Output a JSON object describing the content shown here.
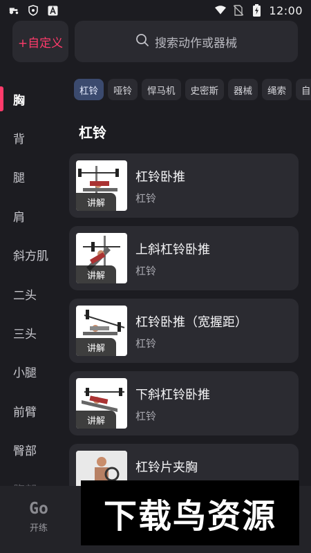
{
  "status_bar": {
    "time": "12:00"
  },
  "header": {
    "custom_label": "+自定义",
    "search_placeholder": "搜索动作或器械"
  },
  "sidebar": {
    "items": [
      "胸",
      "背",
      "腿",
      "肩",
      "斜方肌",
      "二头",
      "三头",
      "小腿",
      "前臂",
      "臀部",
      "腹部"
    ]
  },
  "chips": [
    "杠铃",
    "哑铃",
    "悍马机",
    "史密斯",
    "器械",
    "绳索",
    "自"
  ],
  "section_title": "杠铃",
  "exercises": [
    {
      "name": "杠铃卧推",
      "equipment": "杠铃",
      "tag": "讲解"
    },
    {
      "name": "上斜杠铃卧推",
      "equipment": "杠铃",
      "tag": "讲解"
    },
    {
      "name": "杠铃卧推（宽握距）",
      "equipment": "杠铃",
      "tag": "讲解"
    },
    {
      "name": "下斜杠铃卧推",
      "equipment": "杠铃",
      "tag": "讲解"
    },
    {
      "name": "杠铃片夹胸",
      "equipment": "",
      "tag": ""
    }
  ],
  "bottom_nav": {
    "logo": "Go",
    "label": "开练"
  },
  "watermark": "下载鸟资源",
  "colors": {
    "accent": "#ff3b6b",
    "background": "#1c1c21",
    "card": "#2b2b31",
    "chip_active": "#3b4a6e"
  },
  "icons": {
    "status_left": [
      "tractor-icon",
      "shield-icon",
      "a-square-icon"
    ],
    "status_right": [
      "wifi-icon",
      "no-sim-icon",
      "battery-charging-icon"
    ],
    "search": "search-icon"
  }
}
